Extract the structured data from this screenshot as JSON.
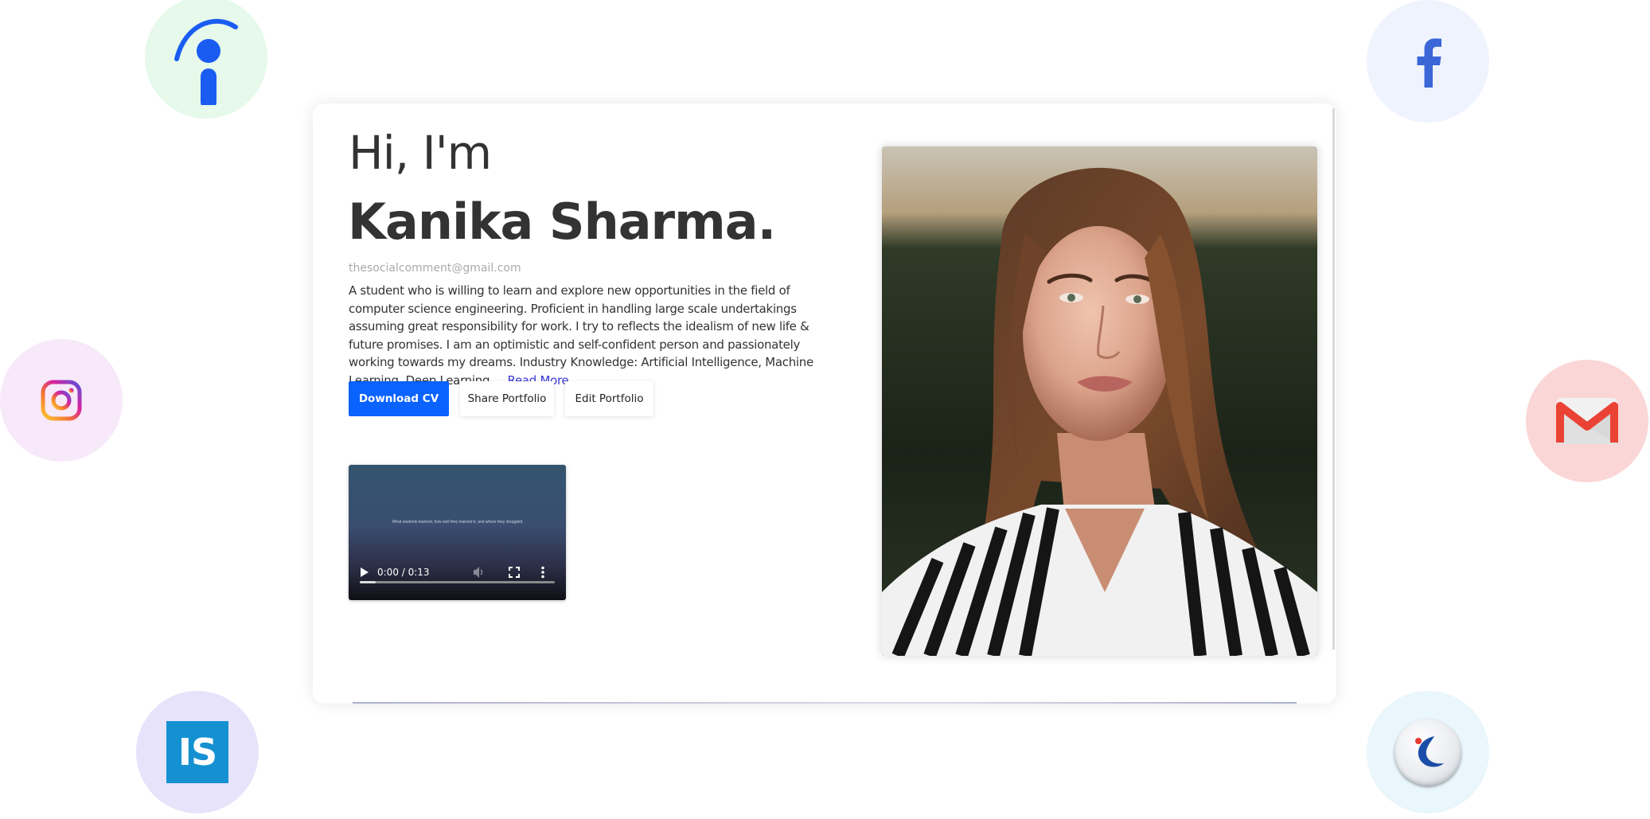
{
  "profile": {
    "greeting": "Hi, I'm",
    "name": "Kanika Sharma.",
    "email": "thesocialcomment@gmail.com",
    "bio": "A student who is willing to learn and explore new opportunities in the field of computer science engineering. Proficient in handling large scale undertakings assuming great responsibility for work. I try to reflects the idealism of new life & future promises. I am an optimistic and self-confident person and passionately working towards my dreams. Industry Knowledge: Artificial Intelligence, Machine Learning, Deep Learning, ...",
    "read_more": "Read More"
  },
  "actions": {
    "download_cv": "Download CV",
    "share_portfolio": "Share Portfolio",
    "edit_portfolio": "Edit Portfolio"
  },
  "video": {
    "caption": "What students learned, how well they learned it, and where they struggled",
    "time": "0:00 / 0:13",
    "progress": 0.08
  },
  "social_links": [
    {
      "name": "Indeed",
      "icon": "indeed-icon",
      "color": "#2164f3"
    },
    {
      "name": "Facebook",
      "icon": "facebook-icon",
      "color": "#3b66d8"
    },
    {
      "name": "Instagram",
      "icon": "instagram-icon",
      "color": "#d6249f"
    },
    {
      "name": "Gmail",
      "icon": "gmail-icon",
      "color": "#ea4335"
    },
    {
      "name": "IS",
      "icon": "is-icon",
      "color": "#1591d2",
      "label": "IS"
    },
    {
      "name": "Naukri",
      "icon": "naukri-icon",
      "color": "#1b4ea8"
    }
  ],
  "colors": {
    "primary": "#0a62ff",
    "link": "#3a37d6",
    "text": "#333333"
  }
}
